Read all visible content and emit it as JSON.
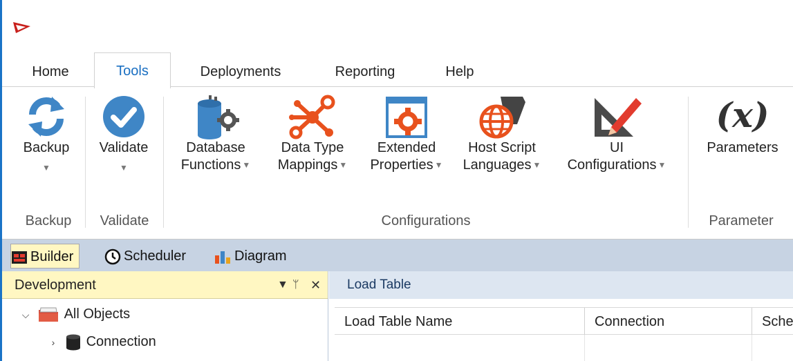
{
  "tabs": [
    {
      "label": "Home"
    },
    {
      "label": "Tools",
      "active": true
    },
    {
      "label": "Deployments"
    },
    {
      "label": "Reporting"
    },
    {
      "label": "Help"
    }
  ],
  "ribbon": {
    "backup": {
      "label": "Backup",
      "icon": "refresh-icon"
    },
    "validate": {
      "label": "Validate",
      "icon": "checkmark-icon"
    },
    "database_functions": {
      "line1": "Database",
      "line2": "Functions",
      "icon": "database-gear-icon"
    },
    "data_type_mappings": {
      "line1": "Data Type",
      "line2": "Mappings",
      "icon": "network-nodes-icon"
    },
    "extended_properties": {
      "line1": "Extended",
      "line2": "Properties",
      "icon": "window-gear-icon"
    },
    "host_script_languages": {
      "line1": "Host Script",
      "line2": "Languages",
      "icon": "globe-script-icon"
    },
    "ui_configurations": {
      "line1": "UI",
      "line2": "Configurations",
      "icon": "triangle-pencil-icon"
    },
    "parameters": {
      "label": "Parameters",
      "icon": "function-x-icon"
    },
    "groups": {
      "backup": "Backup",
      "validate": "Validate",
      "configurations": "Configurations",
      "parameter": "Parameter"
    }
  },
  "dock_tabs": [
    {
      "label": "Builder",
      "icon": "builder-icon",
      "active": true
    },
    {
      "label": "Scheduler",
      "icon": "clock-icon"
    },
    {
      "label": "Diagram",
      "icon": "bar-chart-icon"
    }
  ],
  "dev_panel": {
    "title": "Development",
    "tree": [
      {
        "label": "All Objects",
        "expanded": true,
        "icon": "folder-icon"
      },
      {
        "label": "Connection",
        "expanded": false,
        "icon": "database-icon"
      }
    ]
  },
  "load_panel": {
    "title": "Load Table",
    "columns": [
      "Load Table Name",
      "Connection",
      "Sche"
    ]
  },
  "colors": {
    "accent": "#1a6fc2",
    "icon_blue": "#3f86c6",
    "icon_orange": "#e8511d",
    "panel_yellow": "#fff7c2",
    "dock_blue": "#c7d3e3"
  }
}
